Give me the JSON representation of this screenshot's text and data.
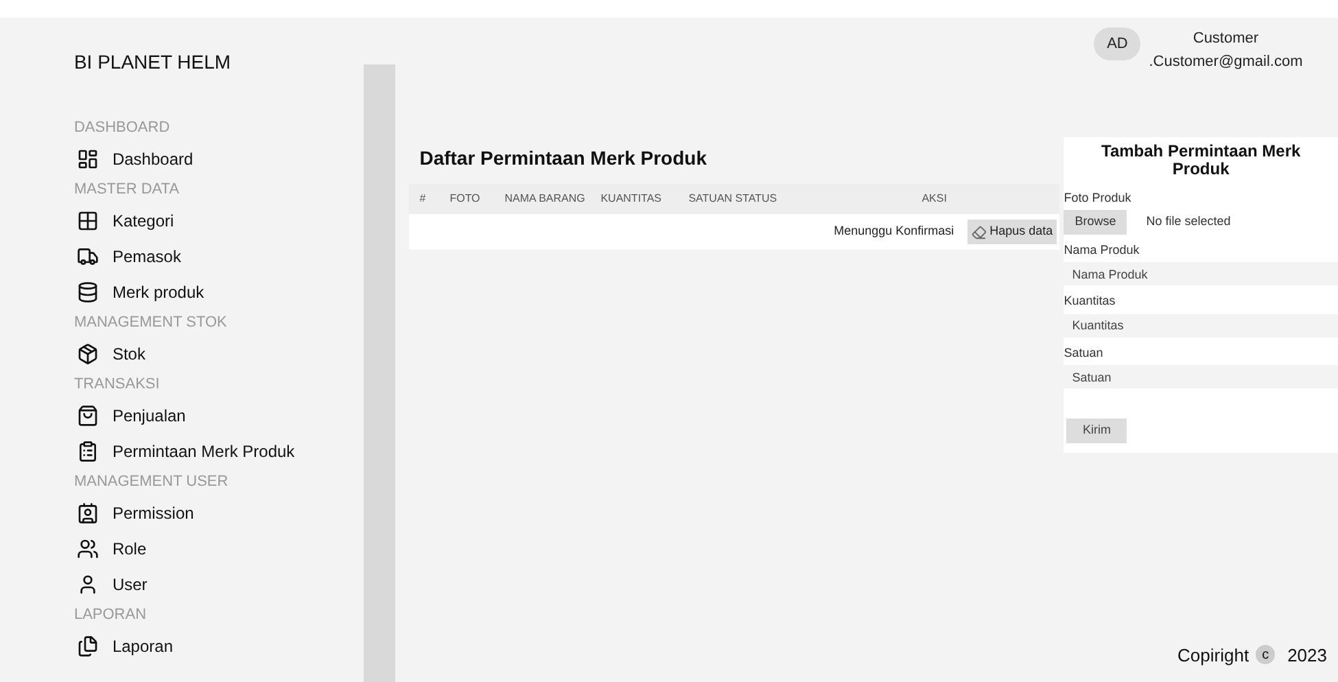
{
  "brand": "BI PLANET HELM",
  "user": {
    "initials": "AD",
    "name": "Customer",
    "email": ".Customer@gmail.com"
  },
  "sidebar": {
    "sections": [
      {
        "title": "DASHBOARD",
        "items": [
          "Dashboard"
        ]
      },
      {
        "title": "MASTER DATA",
        "items": [
          "Kategori",
          "Pemasok",
          "Merk produk"
        ]
      },
      {
        "title": "MANAGEMENT STOK",
        "items": [
          "Stok"
        ]
      },
      {
        "title": "TRANSAKSI",
        "items": [
          "Penjualan",
          "Permintaan Merk Produk"
        ]
      },
      {
        "title": "MANAGEMENT USER",
        "items": [
          "Permission",
          "Role",
          "User"
        ]
      },
      {
        "title": "LAPORAN",
        "items": [
          "Laporan"
        ]
      }
    ]
  },
  "table": {
    "title": "Daftar Permintaan Merk Produk",
    "columns": [
      "#",
      "FOTO",
      "NAMA BARANG",
      "KUANTITAS",
      "SATUAN",
      "STATUS",
      "AKSI"
    ],
    "rows": [
      {
        "status": "Menunggu Konfirmasi",
        "action": "Hapus data"
      }
    ]
  },
  "form": {
    "title": "Tambah Permintaan Merk Produk",
    "photo_label": "Foto Produk",
    "browse": "Browse",
    "file_status": "No file selected",
    "fields": [
      {
        "label": "Nama Produk",
        "placeholder": "Nama Produk"
      },
      {
        "label": "Kuantitas",
        "placeholder": "Kuantitas"
      },
      {
        "label": "Satuan",
        "placeholder": "Satuan"
      }
    ],
    "submit": "Kirim"
  },
  "footer": {
    "text": "Copiright",
    "symbol": "c",
    "year": "2023"
  }
}
